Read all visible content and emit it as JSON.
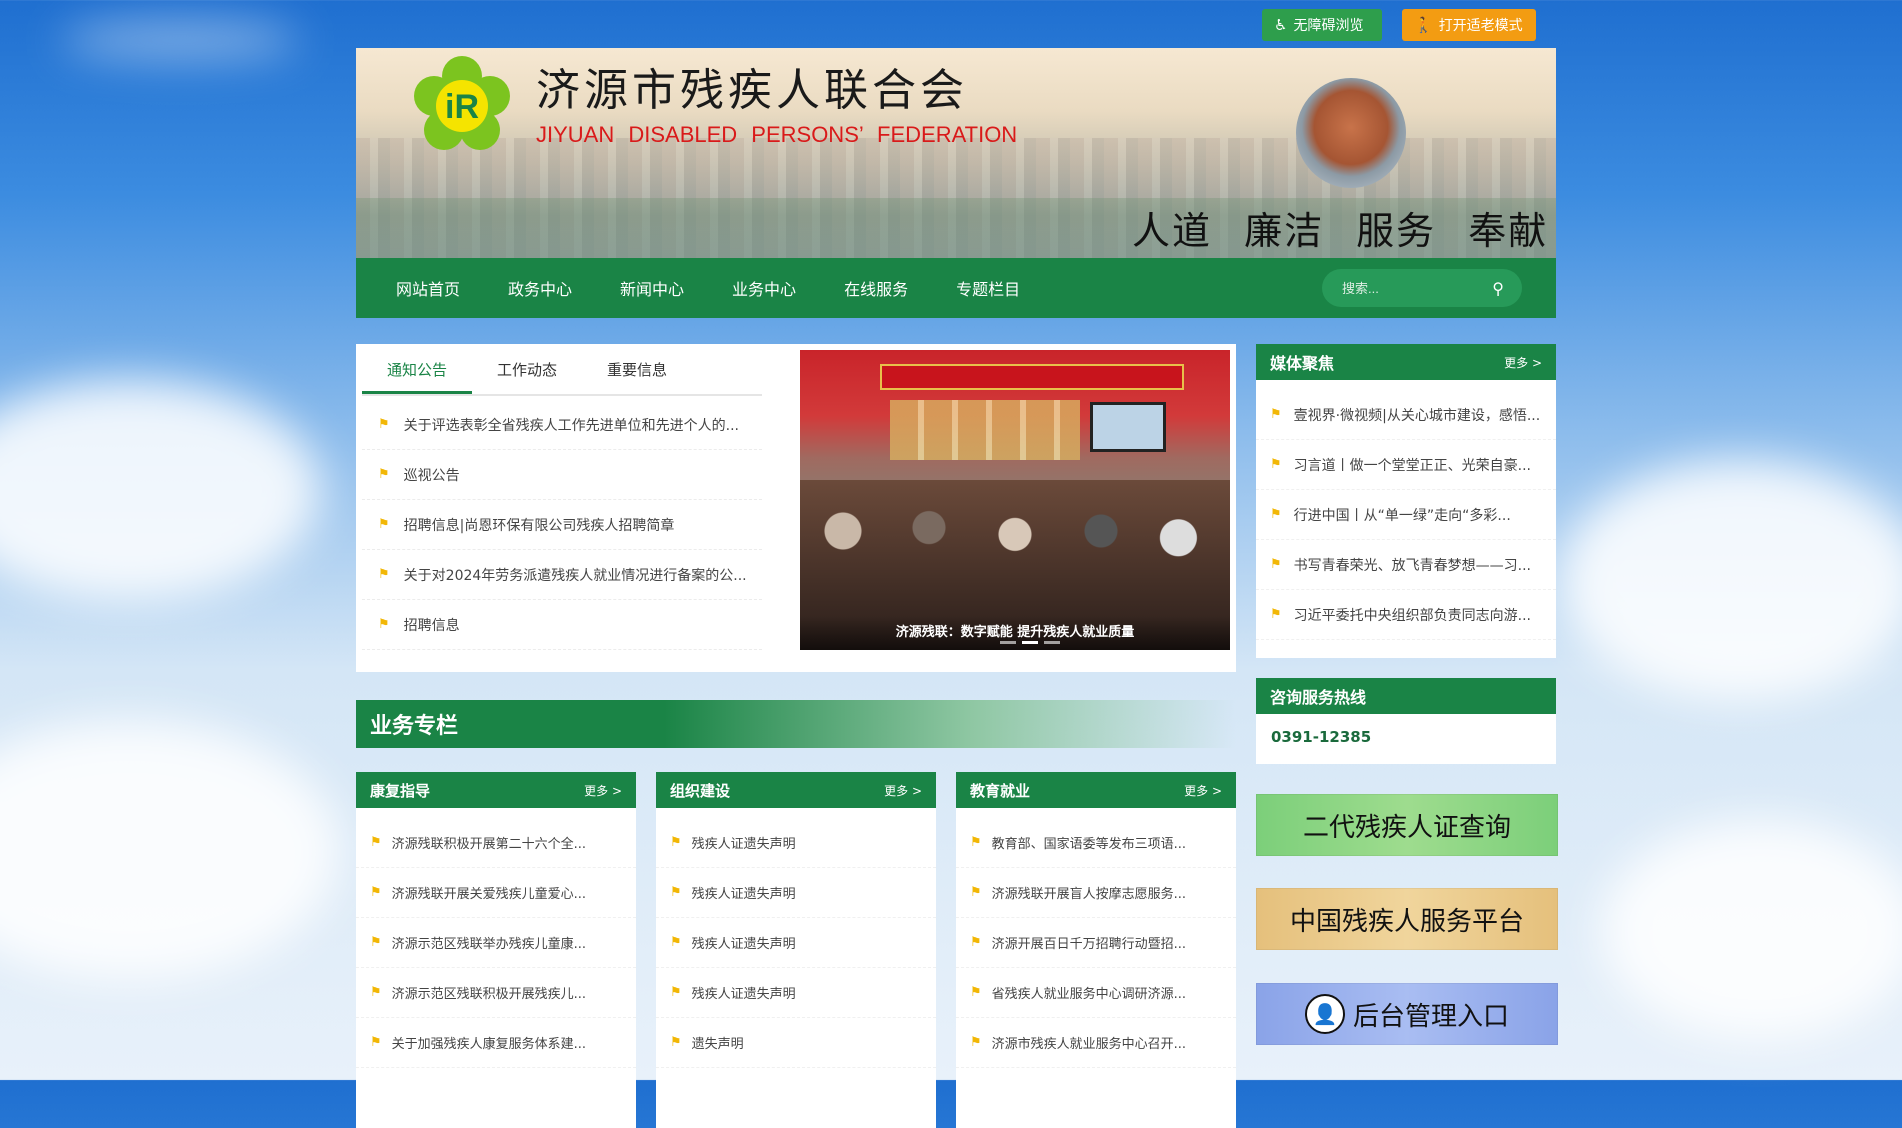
{
  "top_buttons": {
    "accessible": "无障碍浏览",
    "elder": "打开适老模式"
  },
  "header": {
    "title_cn": "济源市残疾人联合会",
    "title_en": "JIYUAN DISABLED  PERSONS’  FEDERATION",
    "slogan": "人道 廉洁 服务 奉献"
  },
  "nav": {
    "items": [
      "网站首页",
      "政务中心",
      "新闻中心",
      "业务中心",
      "在线服务",
      "专题栏目"
    ],
    "search_placeholder": "搜索..."
  },
  "news": {
    "tabs": [
      "通知公告",
      "工作动态",
      "重要信息"
    ],
    "items": [
      "关于评选表彰全省残疾人工作先进单位和先进个人的...",
      "巡视公告",
      "招聘信息|尚恩环保有限公司残疾人招聘简章",
      "关于对2024年劳务派遣残疾人就业情况进行备案的公...",
      "招聘信息"
    ],
    "photo_caption": "济源残联：数字赋能 提升残疾人就业质量"
  },
  "media": {
    "title": "媒体聚焦",
    "more": "更多 >",
    "items": [
      "壹视界·微视频|从关心城市建设，感悟...",
      "习言道丨做一个堂堂正正、光荣自豪...",
      "行进中国丨从“单一绿”走向“多彩...",
      "书写青春荣光、放飞青春梦想——习...",
      "习近平委托中央组织部负责同志向游..."
    ]
  },
  "hotline": {
    "title": "咨询服务热线",
    "number": "0391-12385"
  },
  "quick_links": {
    "cert": "二代残疾人证查询",
    "platform": "中国残疾人服务平台",
    "admin": "后台管理入口"
  },
  "business": {
    "title": "业务专栏",
    "columns": [
      {
        "title": "康复指导",
        "more": "更多 >",
        "items": [
          "济源残联积极开展第二十六个全...",
          "济源残联开展关爱残疾儿童爱心...",
          "济源示范区残联举办残疾儿童康...",
          "济源示范区残联积极开展残疾儿...",
          "关于加强残疾人康复服务体系建..."
        ]
      },
      {
        "title": "组织建设",
        "more": "更多 >",
        "items": [
          "残疾人证遗失声明",
          "残疾人证遗失声明",
          "残疾人证遗失声明",
          "残疾人证遗失声明",
          "遗失声明"
        ]
      },
      {
        "title": "教育就业",
        "more": "更多 >",
        "items": [
          "教育部、国家语委等发布三项语...",
          "济源残联开展盲人按摩志愿服务...",
          "济源开展百日千万招聘行动暨招...",
          "省残疾人就业服务中心调研济源...",
          "济源市残疾人就业服务中心召开..."
        ]
      }
    ]
  },
  "colors": {
    "brand_green": "#1a8446",
    "accent_orange": "#f39c12",
    "flag_yellow": "#f2b705",
    "title_red": "#d91a1a"
  }
}
